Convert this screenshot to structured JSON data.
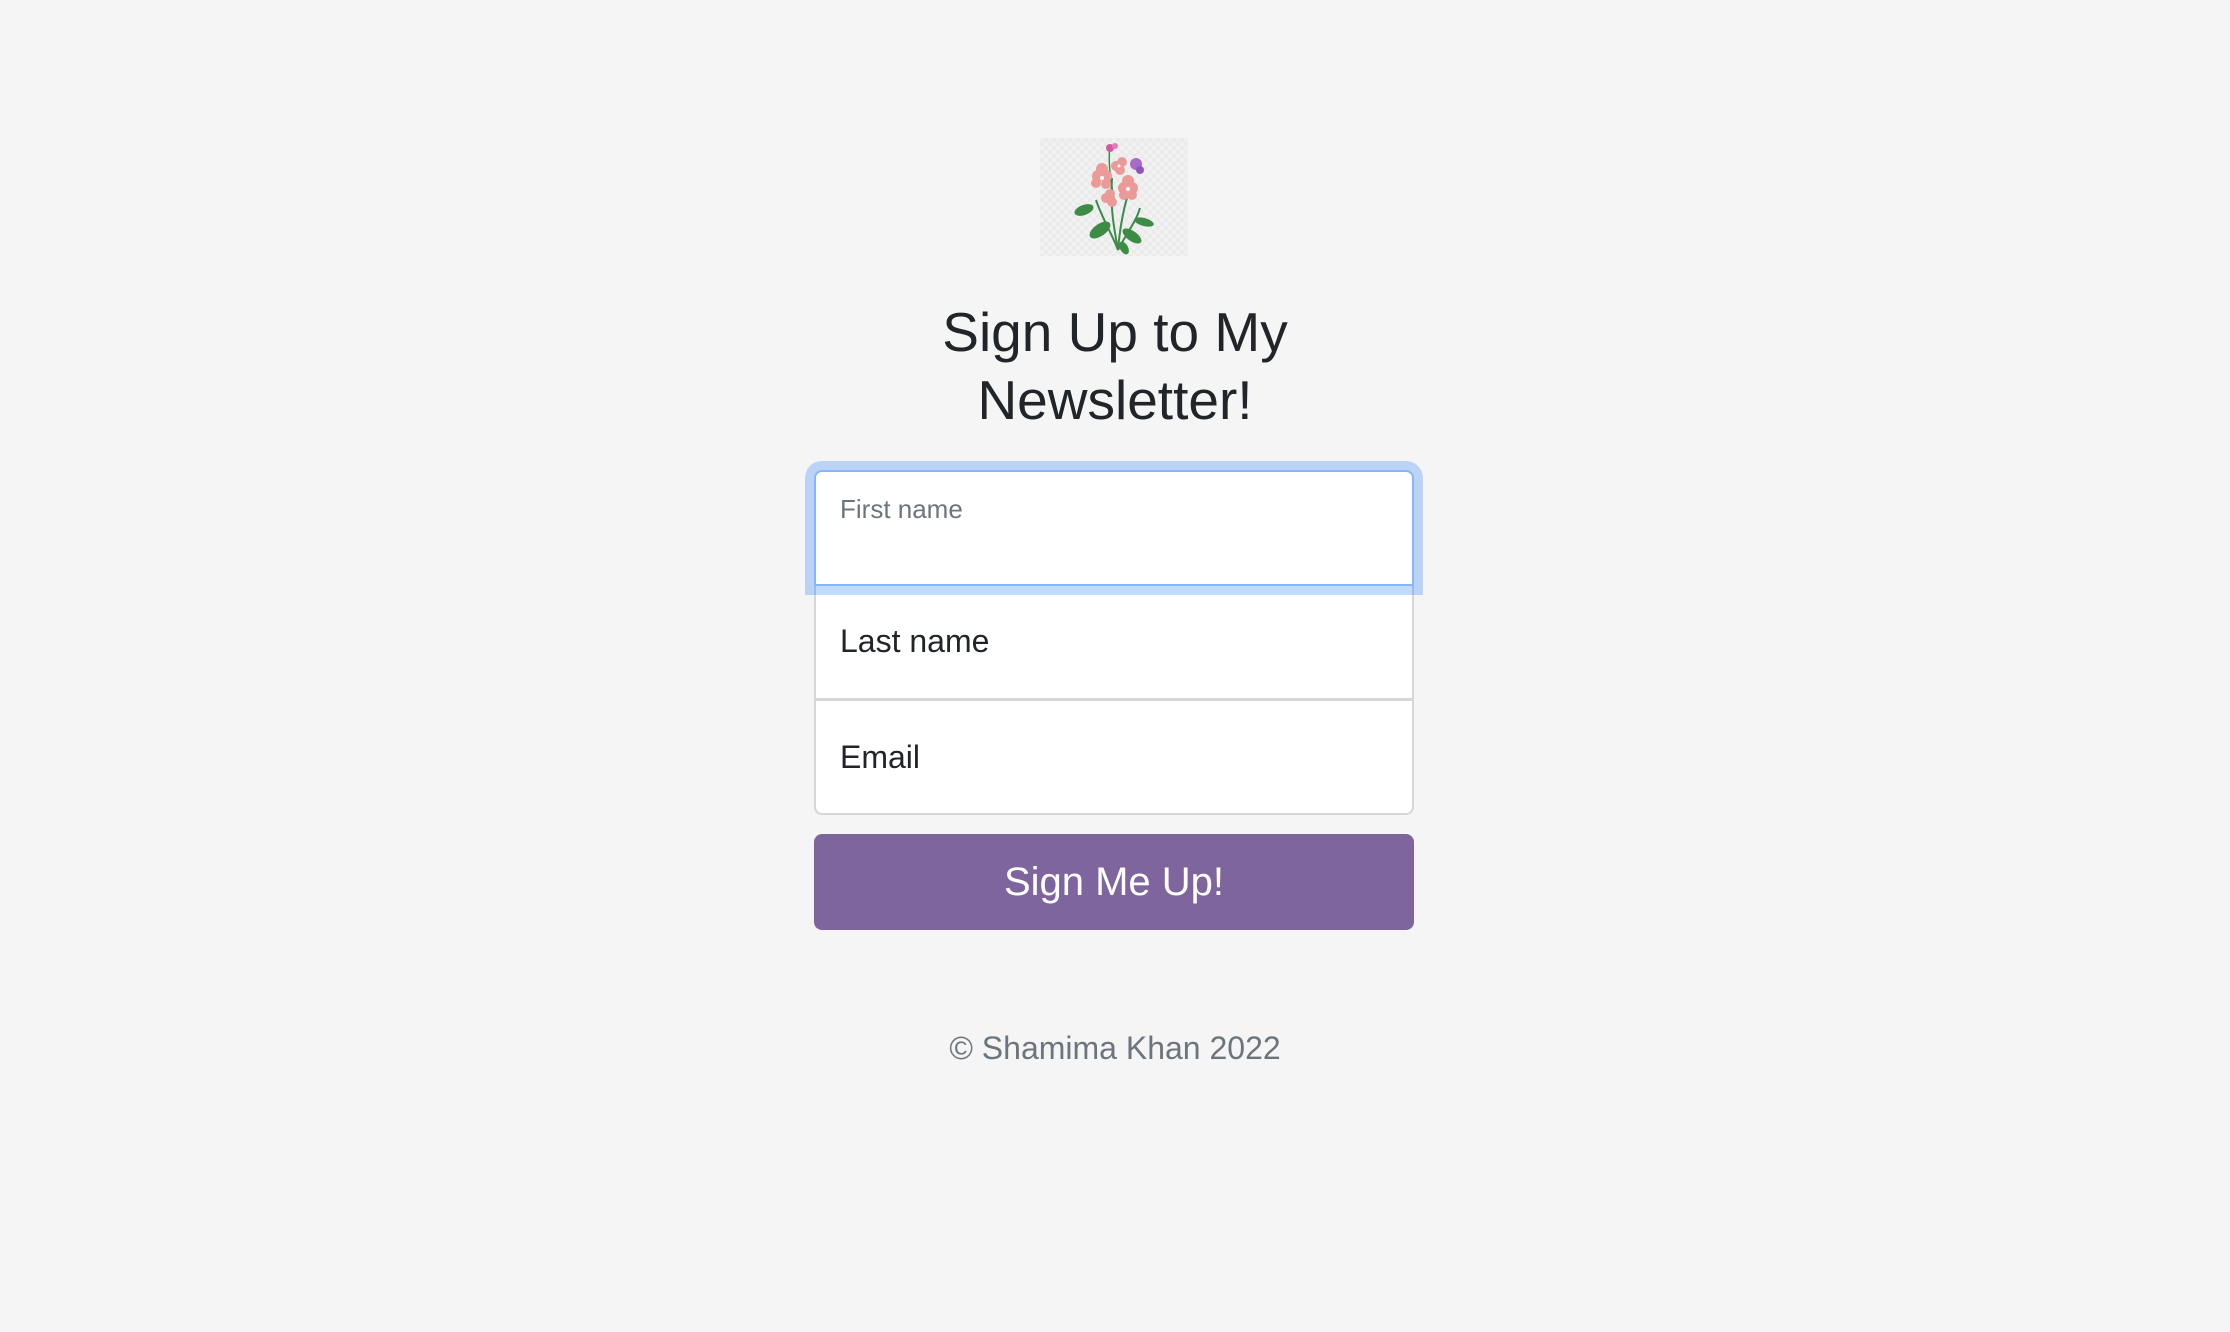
{
  "logo": {
    "icon": "flower-bouquet-icon"
  },
  "heading": {
    "title": "Sign Up to My Newsletter!"
  },
  "form": {
    "first_name": {
      "label": "First name",
      "value": ""
    },
    "last_name": {
      "placeholder": "Last name"
    },
    "email": {
      "placeholder": "Email"
    },
    "submit_label": "Sign Me Up!"
  },
  "footer": {
    "copyright": "© Shamima Khan 2022"
  },
  "colors": {
    "background": "#f5f5f5",
    "button": "#7f659e",
    "focus_ring": "#86b7fe"
  }
}
